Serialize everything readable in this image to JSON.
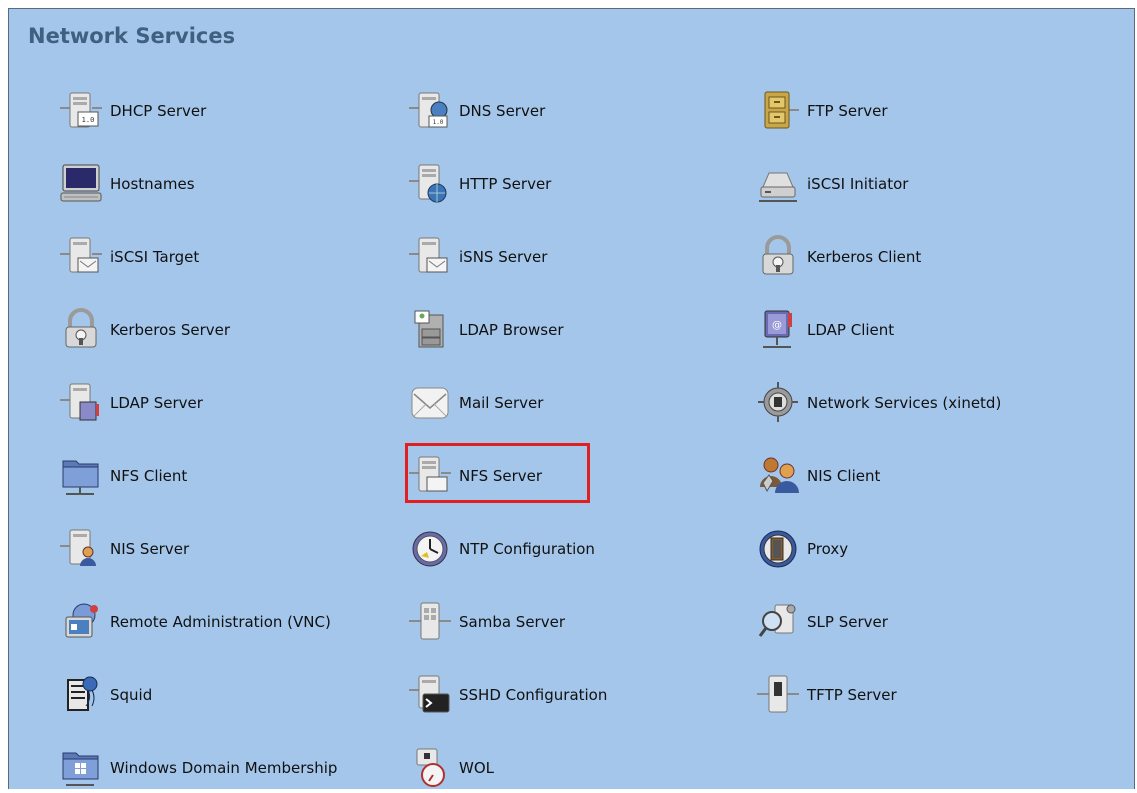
{
  "panel": {
    "title": "Network Services"
  },
  "accent_highlight_color": "#e02020",
  "services": [
    {
      "label": "DHCP Server",
      "icon": "dhcp-server-icon"
    },
    {
      "label": "DNS Server",
      "icon": "dns-server-icon"
    },
    {
      "label": "FTP Server",
      "icon": "ftp-server-icon"
    },
    {
      "label": "Hostnames",
      "icon": "hostnames-icon"
    },
    {
      "label": "HTTP Server",
      "icon": "http-server-icon"
    },
    {
      "label": "iSCSI Initiator",
      "icon": "iscsi-initiator-icon"
    },
    {
      "label": "iSCSI Target",
      "icon": "iscsi-target-icon"
    },
    {
      "label": "iSNS Server",
      "icon": "isns-server-icon"
    },
    {
      "label": "Kerberos Client",
      "icon": "kerberos-client-icon"
    },
    {
      "label": "Kerberos Server",
      "icon": "kerberos-server-icon"
    },
    {
      "label": "LDAP Browser",
      "icon": "ldap-browser-icon"
    },
    {
      "label": "LDAP Client",
      "icon": "ldap-client-icon"
    },
    {
      "label": "LDAP Server",
      "icon": "ldap-server-icon"
    },
    {
      "label": "Mail Server",
      "icon": "mail-server-icon"
    },
    {
      "label": "Network Services (xinetd)",
      "icon": "xinetd-icon"
    },
    {
      "label": "NFS Client",
      "icon": "nfs-client-icon"
    },
    {
      "label": "NFS Server",
      "icon": "nfs-server-icon",
      "highlighted": true
    },
    {
      "label": "NIS Client",
      "icon": "nis-client-icon"
    },
    {
      "label": "NIS Server",
      "icon": "nis-server-icon"
    },
    {
      "label": "NTP Configuration",
      "icon": "ntp-configuration-icon"
    },
    {
      "label": "Proxy",
      "icon": "proxy-icon"
    },
    {
      "label": "Remote Administration (VNC)",
      "icon": "remote-administration-icon"
    },
    {
      "label": "Samba Server",
      "icon": "samba-server-icon"
    },
    {
      "label": "SLP Server",
      "icon": "slp-server-icon"
    },
    {
      "label": "Squid",
      "icon": "squid-icon"
    },
    {
      "label": "SSHD Configuration",
      "icon": "sshd-configuration-icon"
    },
    {
      "label": "TFTP Server",
      "icon": "tftp-server-icon"
    },
    {
      "label": "Windows Domain Membership",
      "icon": "windows-domain-icon"
    },
    {
      "label": "WOL",
      "icon": "wol-icon"
    }
  ]
}
